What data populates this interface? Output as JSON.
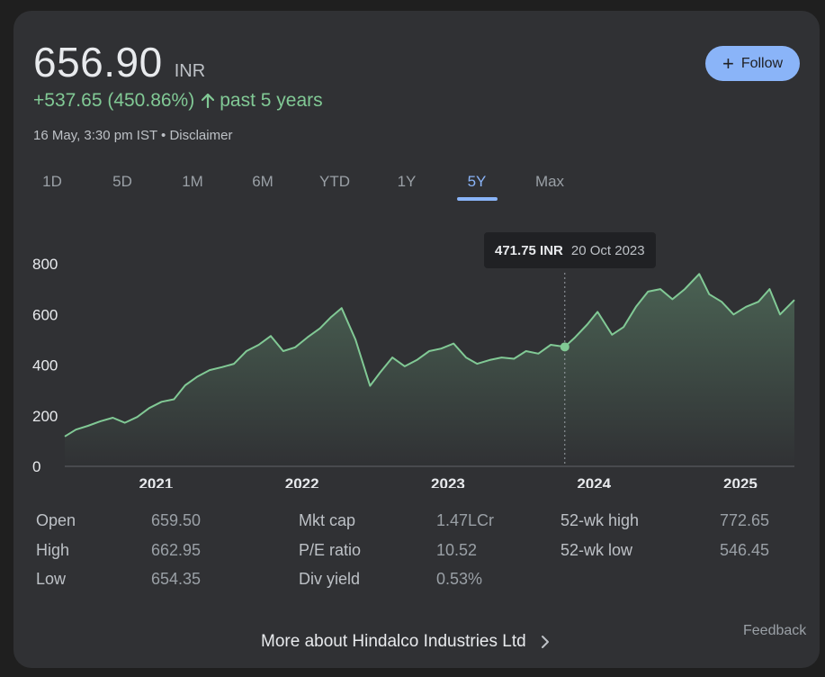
{
  "header": {
    "price": "656.90",
    "currency": "INR",
    "change": "+537.65 (450.86%)",
    "period": "past 5 years",
    "timestamp": "16 May, 3:30 pm IST",
    "separator": " • ",
    "disclaimer": "Disclaimer"
  },
  "follow": {
    "label": "Follow",
    "icon": "plus-icon"
  },
  "tabs": [
    {
      "label": "1D"
    },
    {
      "label": "5D"
    },
    {
      "label": "1M"
    },
    {
      "label": "6M"
    },
    {
      "label": "YTD"
    },
    {
      "label": "1Y"
    },
    {
      "label": "5Y",
      "active": true
    },
    {
      "label": "Max"
    }
  ],
  "tooltip": {
    "value": "471.75 INR",
    "date": "20 Oct 2023"
  },
  "colors": {
    "line": "#81c995",
    "accent": "#8ab4f8",
    "card": "#303134",
    "background": "#1f1f1f"
  },
  "chart_data": {
    "type": "area",
    "title": "",
    "xlabel": "",
    "ylabel": "",
    "ylim": [
      0,
      800
    ],
    "yticks": [
      "0",
      "200",
      "400",
      "600",
      "800"
    ],
    "xticks": [
      "2021",
      "2022",
      "2023",
      "2024",
      "2025"
    ],
    "grid": false,
    "highlight": {
      "x": "2023-10-20",
      "y": 471.75
    },
    "series": [
      {
        "points": [
          [
            "2020-05-18",
            118
          ],
          [
            "2020-06-15",
            145
          ],
          [
            "2020-07-15",
            160
          ],
          [
            "2020-08-15",
            178
          ],
          [
            "2020-09-15",
            192
          ],
          [
            "2020-10-15",
            172
          ],
          [
            "2020-11-15",
            195
          ],
          [
            "2020-12-15",
            230
          ],
          [
            "2021-01-15",
            255
          ],
          [
            "2021-02-15",
            265
          ],
          [
            "2021-03-15",
            320
          ],
          [
            "2021-04-15",
            355
          ],
          [
            "2021-05-15",
            380
          ],
          [
            "2021-06-15",
            392
          ],
          [
            "2021-07-15",
            405
          ],
          [
            "2021-08-15",
            455
          ],
          [
            "2021-09-15",
            480
          ],
          [
            "2021-10-15",
            515
          ],
          [
            "2021-11-15",
            455
          ],
          [
            "2021-12-15",
            470
          ],
          [
            "2022-01-15",
            510
          ],
          [
            "2022-02-15",
            545
          ],
          [
            "2022-03-15",
            590
          ],
          [
            "2022-04-10",
            625
          ],
          [
            "2022-05-15",
            500
          ],
          [
            "2022-06-20",
            318
          ],
          [
            "2022-07-15",
            370
          ],
          [
            "2022-08-15",
            430
          ],
          [
            "2022-09-15",
            395
          ],
          [
            "2022-10-15",
            420
          ],
          [
            "2022-11-15",
            455
          ],
          [
            "2022-12-15",
            465
          ],
          [
            "2023-01-15",
            485
          ],
          [
            "2023-02-15",
            430
          ],
          [
            "2023-03-15",
            405
          ],
          [
            "2023-04-15",
            420
          ],
          [
            "2023-05-15",
            430
          ],
          [
            "2023-06-15",
            425
          ],
          [
            "2023-07-15",
            455
          ],
          [
            "2023-08-15",
            445
          ],
          [
            "2023-09-15",
            480
          ],
          [
            "2023-10-20",
            471.75
          ],
          [
            "2023-11-15",
            510
          ],
          [
            "2023-12-15",
            560
          ],
          [
            "2024-01-10",
            610
          ],
          [
            "2024-02-15",
            520
          ],
          [
            "2024-03-15",
            550
          ],
          [
            "2024-04-15",
            630
          ],
          [
            "2024-05-15",
            690
          ],
          [
            "2024-06-15",
            700
          ],
          [
            "2024-07-15",
            660
          ],
          [
            "2024-08-15",
            700
          ],
          [
            "2024-09-20",
            760
          ],
          [
            "2024-10-15",
            680
          ],
          [
            "2024-11-15",
            650
          ],
          [
            "2024-12-15",
            600
          ],
          [
            "2025-01-15",
            630
          ],
          [
            "2025-02-15",
            650
          ],
          [
            "2025-03-15",
            700
          ],
          [
            "2025-04-10",
            600
          ],
          [
            "2025-05-16",
            656.9
          ]
        ]
      }
    ]
  },
  "stats": {
    "col1": [
      {
        "label": "Open",
        "value": "659.50"
      },
      {
        "label": "High",
        "value": "662.95"
      },
      {
        "label": "Low",
        "value": "654.35"
      }
    ],
    "col2": [
      {
        "label": "Mkt cap",
        "value": "1.47LCr"
      },
      {
        "label": "P/E ratio",
        "value": "10.52"
      },
      {
        "label": "Div yield",
        "value": "0.53%"
      }
    ],
    "col3": [
      {
        "label": "52-wk high",
        "value": "772.65"
      },
      {
        "label": "52-wk low",
        "value": "546.45"
      }
    ]
  },
  "footer": {
    "more_label": "More about Hindalco Industries Ltd",
    "feedback_label": "Feedback"
  }
}
